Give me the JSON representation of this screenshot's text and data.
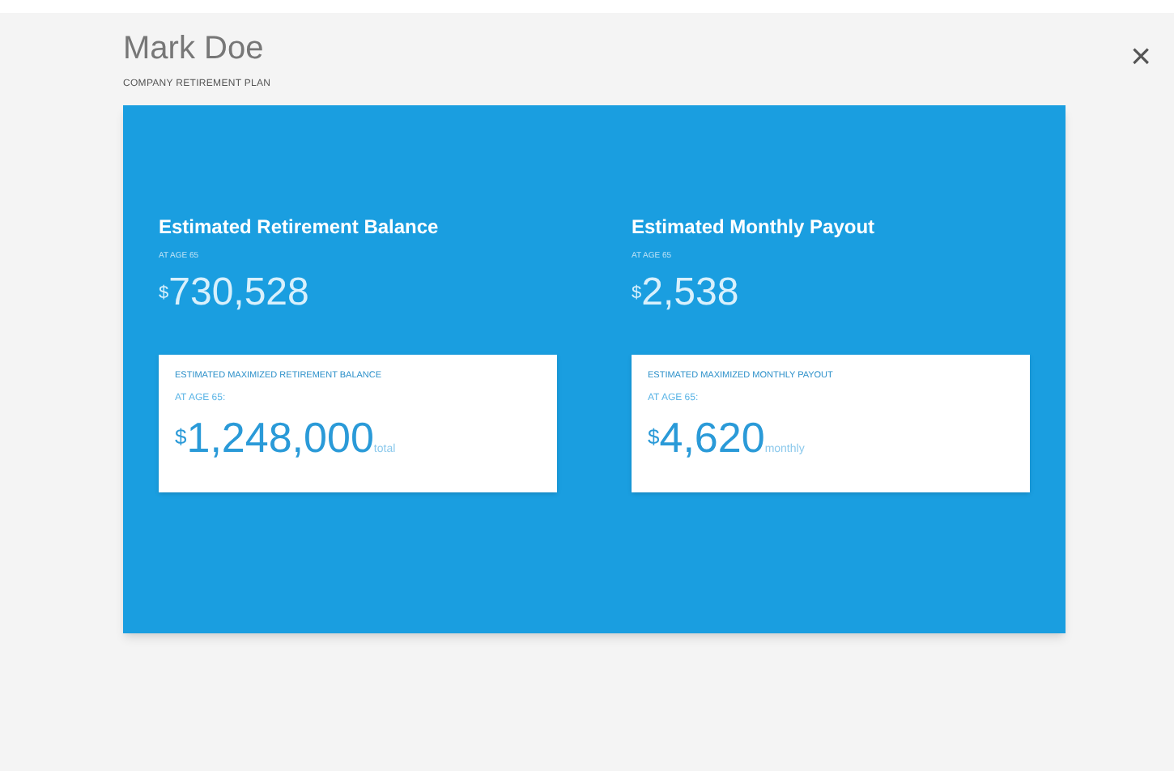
{
  "header": {
    "name": "Mark Doe",
    "subtitle": "COMPANY RETIREMENT PLAN",
    "close": "×"
  },
  "estimates": [
    {
      "title": "Estimated Retirement Balance",
      "age": "AT AGE 65",
      "currency": "$",
      "amount": "730,528",
      "max": {
        "title": "ESTIMATED MAXIMIZED RETIREMENT BALANCE",
        "age": "AT AGE 65:",
        "currency": "$",
        "amount": "1,248,000",
        "unit": "total"
      }
    },
    {
      "title": "Estimated Monthly Payout",
      "age": "AT AGE 65",
      "currency": "$",
      "amount": "2,538",
      "max": {
        "title": "ESTIMATED MAXIMIZED MONTHLY PAYOUT",
        "age": "AT AGE 65:",
        "currency": "$",
        "amount": "4,620",
        "unit": "monthly"
      }
    }
  ]
}
